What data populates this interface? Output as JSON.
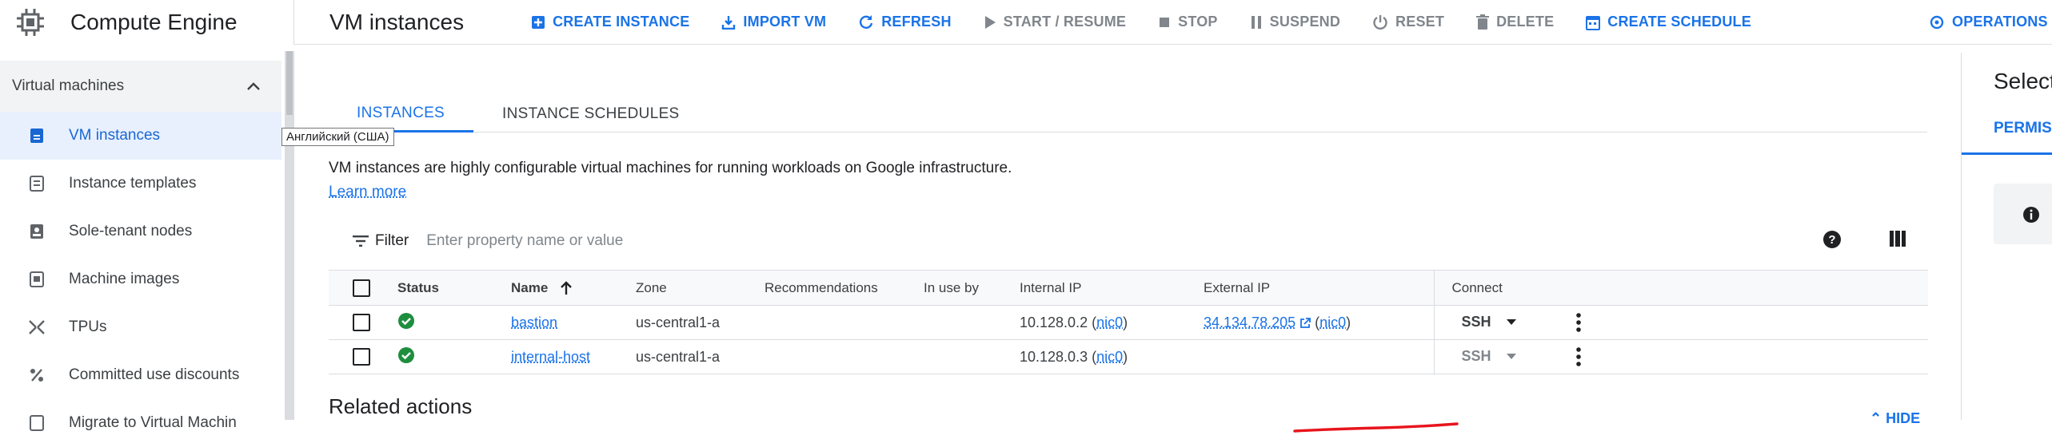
{
  "app": {
    "title": "Compute Engine"
  },
  "sidebar": {
    "section": "Virtual machines",
    "items": [
      {
        "label": "VM instances",
        "icon": "vm-instance-icon",
        "active": true
      },
      {
        "label": "Instance templates",
        "icon": "template-icon"
      },
      {
        "label": "Sole-tenant nodes",
        "icon": "sole-tenant-icon"
      },
      {
        "label": "Machine images",
        "icon": "machine-image-icon"
      },
      {
        "label": "TPUs",
        "icon": "tpu-icon"
      },
      {
        "label": "Committed use discounts",
        "icon": "discount-icon"
      },
      {
        "label": "Migrate to Virtual Machin",
        "icon": "migrate-icon"
      }
    ]
  },
  "tooltip": "Английский (США)",
  "toolbar": {
    "page_title": "VM instances",
    "buttons": [
      {
        "label": "CREATE INSTANCE",
        "icon": "add-box-icon",
        "enabled": true
      },
      {
        "label": "IMPORT VM",
        "icon": "import-icon",
        "enabled": true
      },
      {
        "label": "REFRESH",
        "icon": "refresh-icon",
        "enabled": true
      },
      {
        "label": "START / RESUME",
        "icon": "play-icon",
        "enabled": false
      },
      {
        "label": "STOP",
        "icon": "stop-icon",
        "enabled": false
      },
      {
        "label": "SUSPEND",
        "icon": "pause-icon",
        "enabled": false
      },
      {
        "label": "RESET",
        "icon": "power-icon",
        "enabled": false
      },
      {
        "label": "DELETE",
        "icon": "trash-icon",
        "enabled": false
      },
      {
        "label": "CREATE SCHEDULE",
        "icon": "calendar-icon",
        "enabled": true
      },
      {
        "label": "OPERATIONS",
        "icon": "operations-icon",
        "enabled": true
      }
    ]
  },
  "tabs": [
    {
      "label": "INSTANCES",
      "active": true
    },
    {
      "label": "INSTANCE SCHEDULES",
      "active": false
    }
  ],
  "description": {
    "text": "VM instances are highly configurable virtual machines for running workloads on Google infrastructure.",
    "link": "Learn more"
  },
  "filter": {
    "label": "Filter",
    "placeholder": "Enter property name or value"
  },
  "table": {
    "columns": [
      "Status",
      "Name",
      "Zone",
      "Recommendations",
      "In use by",
      "Internal IP",
      "External IP",
      "Connect"
    ],
    "rows": [
      {
        "status": "running",
        "name": "bastion",
        "zone": "us-central1-a",
        "recommendations": "",
        "in_use_by": "",
        "internal_ip": "10.128.0.2",
        "internal_nic": "nic0",
        "external_ip": "34.134.78.205",
        "external_nic": "nic0",
        "connect": "SSH"
      },
      {
        "status": "running",
        "name": "internal-host",
        "zone": "us-central1-a",
        "recommendations": "",
        "in_use_by": "",
        "internal_ip": "10.128.0.3",
        "internal_nic": "nic0",
        "external_ip": "",
        "external_nic": "",
        "connect": "SSH"
      }
    ]
  },
  "related": {
    "title": "Related actions",
    "hide": "HIDE"
  },
  "panel": {
    "title": "Select",
    "tab": "PERMISS"
  },
  "colors": {
    "accent": "#1a73e8",
    "running": "#1e8e3e",
    "annotation": "#e8141c"
  }
}
